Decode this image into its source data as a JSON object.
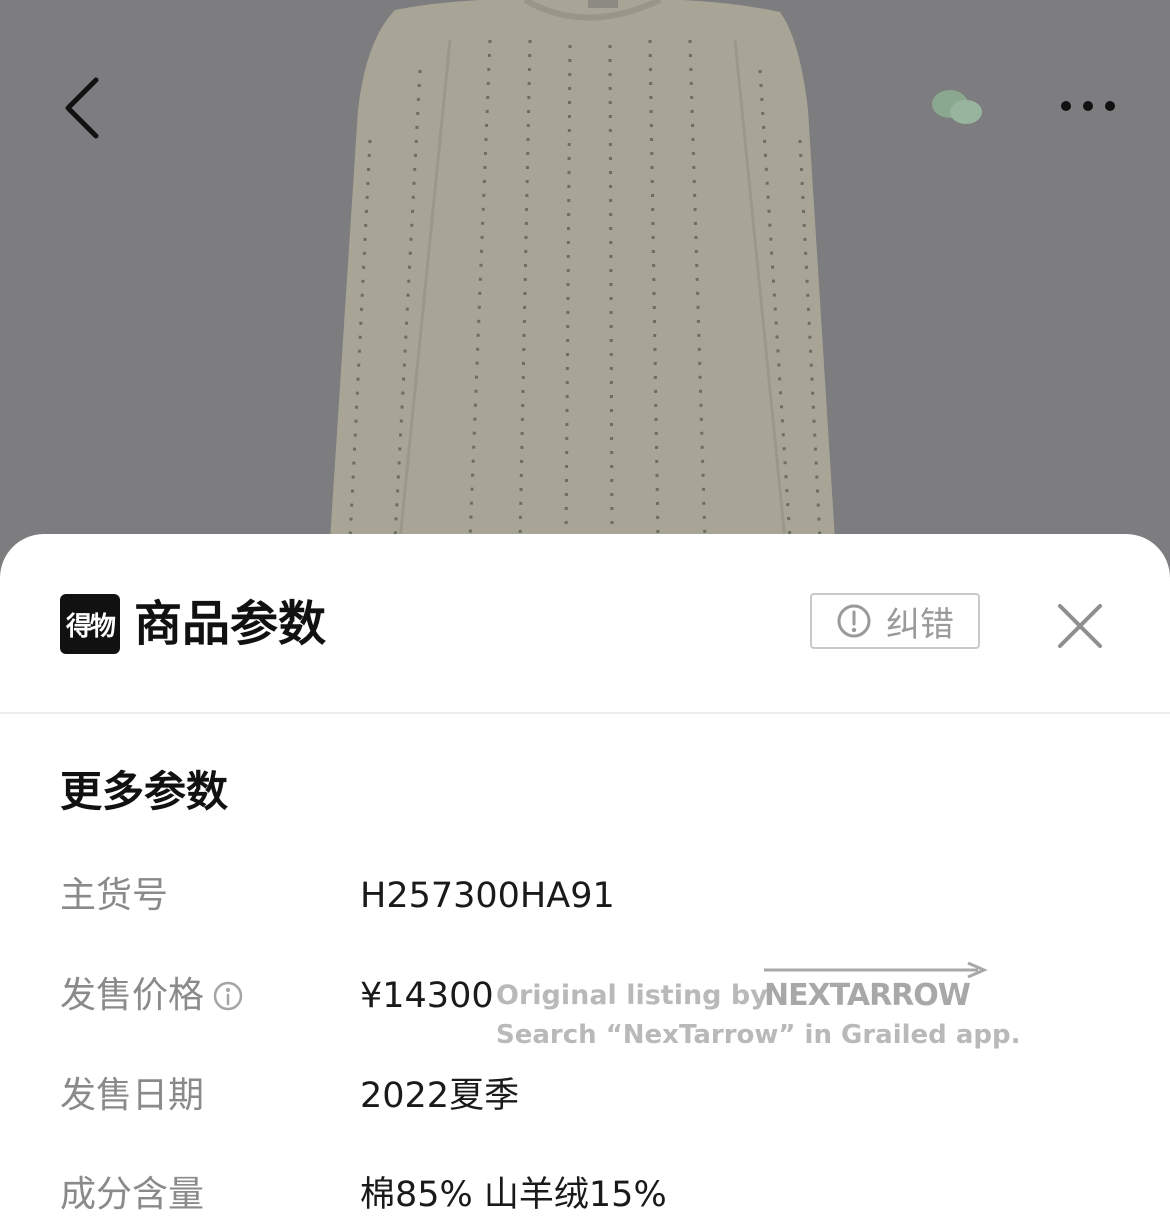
{
  "header": {
    "back_icon": "chevron-left-icon",
    "share_icon": "wechat-icon",
    "more_icon": "more-dots-icon"
  },
  "sheet": {
    "brand_logo_text": "得物",
    "title": "商品参数",
    "report_button": {
      "icon": "alert-circle-icon",
      "label": "纠错"
    },
    "close_icon": "close-icon"
  },
  "section": {
    "title": "更多参数"
  },
  "params": [
    {
      "label": "主货号",
      "value": "H257300HA91"
    },
    {
      "label": "发售价格",
      "value": "¥14300",
      "info_icon": "info-icon"
    },
    {
      "label": "发售日期",
      "value": "2022夏季"
    },
    {
      "label": "成分含量",
      "value": "棉85% 山羊绒15%"
    }
  ],
  "watermark": {
    "line1": "Original listing by",
    "brand": "NEXTARROW",
    "line2": "Search “NexTarrow” in Grailed app."
  },
  "colors": {
    "overlay": "#7d7d7f",
    "sweater": "#d8d2bf",
    "label_gray": "#8a8a8a",
    "text_dark": "#111111"
  }
}
